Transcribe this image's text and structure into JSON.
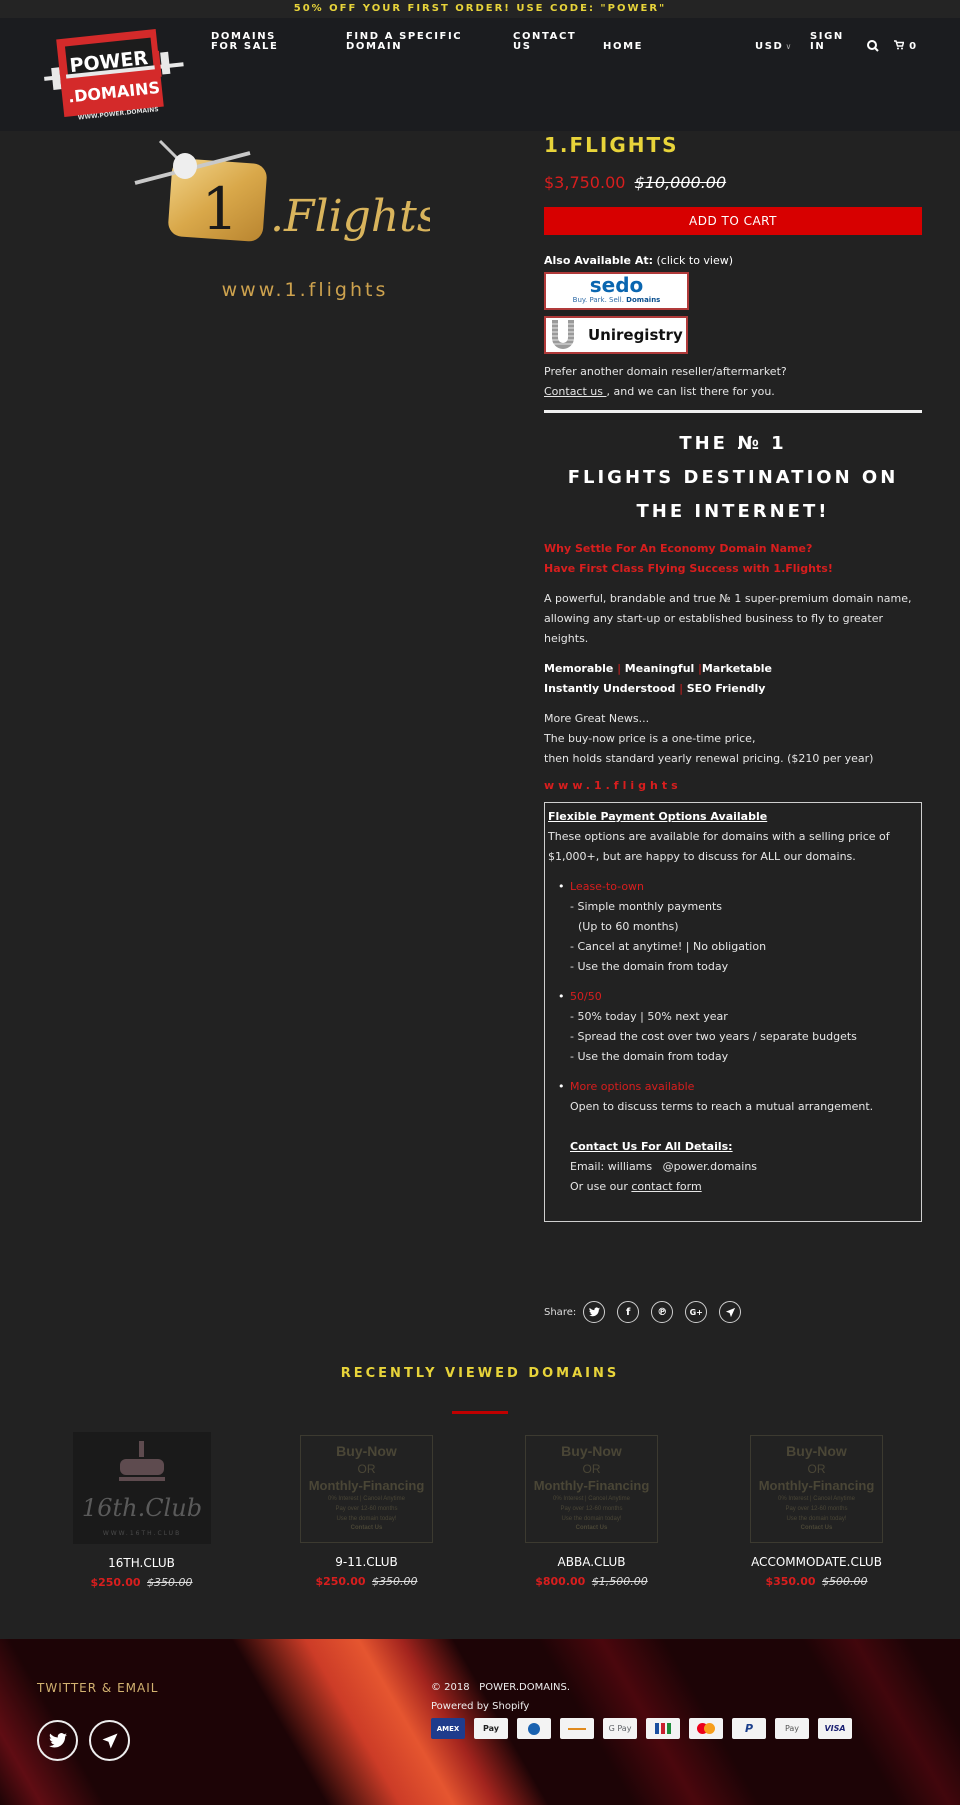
{
  "promo": {
    "text": "50% OFF YOUR FIRST ORDER! USE CODE: \"POWER\""
  },
  "header": {
    "logo": {
      "line1": "POWER",
      "line2": ".DOMAINS",
      "url": "WWW.POWER.DOMAINS"
    },
    "nav": [
      {
        "label": "DOMAINS FOR SALE"
      },
      {
        "label": "FIND A SPECIFIC DOMAIN"
      },
      {
        "label": "CONTACT US"
      },
      {
        "label": "HOME"
      }
    ],
    "currency": "USD",
    "sign_in": "SIGN IN",
    "cart_count": "0"
  },
  "product_image": {
    "brand_one": "1",
    "brand_text": ".Flights",
    "url": "www.1.flights"
  },
  "product": {
    "title": "1.FLIGHTS",
    "price": "$3,750.00",
    "compare_price": "$10,000.00",
    "add_to_cart": "ADD TO CART",
    "also_available_label": "Also Available At:",
    "also_available_hint": "(click to view)",
    "marketplaces": [
      {
        "name": "sedo",
        "tagline_plain": "Buy. Park. Sell.",
        "tagline_bold": "Domains"
      },
      {
        "name": "Uniregistry"
      }
    ],
    "prefer_text": "Prefer another domain reseller/aftermarket?",
    "contact_link": "Contact us ",
    "contact_suffix": ", and we can list there for you.",
    "headline": [
      "THE № 1",
      "FLIGHTS DESTINATION ON",
      "THE INTERNET!"
    ],
    "red_lead": [
      "Why Settle For An Economy Domain Name?",
      "Have First Class Flying Success with 1.Flights!"
    ],
    "description": "A powerful, brandable and true № 1 super-premium domain name, allowing any start-up or established business to fly to greater heights.",
    "features_line1": [
      "Memorable",
      "Meaningful",
      "Marketable"
    ],
    "features_line2": [
      "Instantly Understood",
      "SEO Friendly"
    ],
    "news": [
      "More Great News...",
      "The buy-now price is a one-time price,",
      "then holds standard yearly renewal pricing. ($210 per year)"
    ],
    "www_red": "www.1.flights",
    "payment_options": {
      "title": "Flexible Payment Options Available",
      "intro": "These options are available for domains with a selling price of $1,000+, but are happy to discuss for ALL our domains.",
      "options": [
        {
          "name": "Lease-to-own",
          "lines": [
            "- Simple monthly payments",
            "(Up to 60 months)",
            "- Cancel at anytime! | No obligation",
            "- Use the domain from today"
          ]
        },
        {
          "name": "50/50",
          "lines": [
            "- 50% today | 50% next year",
            "- Spread the cost over two years / separate budgets",
            "- Use the domain from today"
          ]
        },
        {
          "name": "More options available",
          "lines": [
            "Open to discuss terms to reach a mutual arrangement."
          ]
        }
      ],
      "contact_heading": "Contact Us For All Details:",
      "email": "Email: williams   @power.domains",
      "form_prefix": "Or use our ",
      "form_link": "contact form "
    }
  },
  "share": {
    "label": "Share:",
    "icons": [
      "twitter-icon",
      "facebook-icon",
      "pinterest-icon",
      "google-plus-icon",
      "email-icon"
    ]
  },
  "recently_viewed": {
    "title": "RECENTLY VIEWED DOMAINS",
    "placeholder": {
      "line1": "Buy-Now",
      "line2": "OR",
      "line3": "Monthly-Financing",
      "line4": "0% Interest | Cancel Anytime",
      "line5": "Pay over 12-60 months",
      "line6": "Use the domain today!",
      "line7": "Contact Us"
    },
    "cake_text": "16th.Club",
    "cake_url": "WWW.16TH.CLUB",
    "items": [
      {
        "name": "16TH.CLUB",
        "price": "$250.00",
        "compare": "$350.00"
      },
      {
        "name": "9-11.CLUB",
        "price": "$250.00",
        "compare": "$350.00"
      },
      {
        "name": "ABBA.CLUB",
        "price": "$800.00",
        "compare": "$1,500.00"
      },
      {
        "name": "ACCOMMODATE.CLUB",
        "price": "$350.00",
        "compare": "$500.00"
      }
    ]
  },
  "footer": {
    "title": "TWITTER & EMAIL",
    "copyright": "© 2018   POWER.DOMAINS.",
    "powered": "Powered by Shopify",
    "payment_methods": [
      "AMEX",
      "Apple Pay",
      "Diners Club",
      "Discover",
      "G Pay",
      "JCB",
      "Mastercard",
      "PayPal",
      "Shop Pay",
      "VISA"
    ]
  },
  "colors": {
    "accent_yellow": "#e8d43a",
    "accent_red": "#d81e1e",
    "button_red": "#d70000",
    "background": "#222222",
    "header_bg": "#1b1c1f"
  }
}
